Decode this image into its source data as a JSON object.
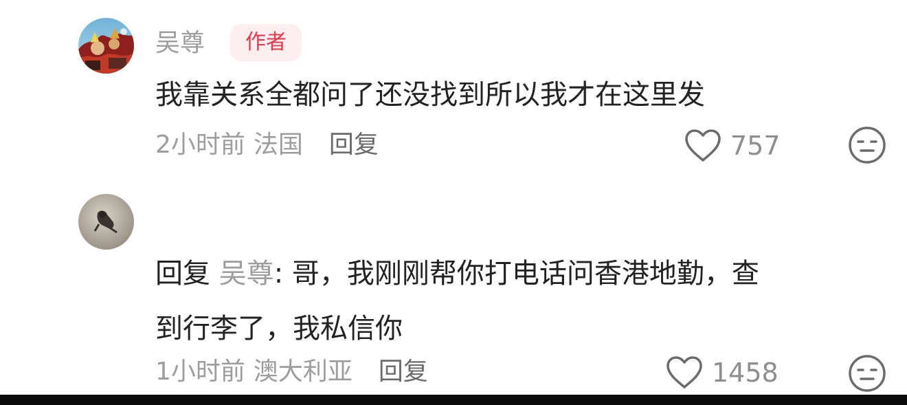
{
  "comments": [
    {
      "username": "吴尊",
      "badge": "作者",
      "text": "我靠关系全都问了还没找到所以我才在这里发",
      "time": "2小时前",
      "location": "法国",
      "reply_label": "回复",
      "likes": "757",
      "like_icon": "heart-outline-icon",
      "dislike_icon": "meh-face-icon"
    },
    {
      "reply_prefix": "回复",
      "reply_to": "吴尊",
      "text_line1": ": 哥，我刚刚帮你打电话问香港地勤，查",
      "text_line2": "到行李了，我私信你",
      "time": "1小时前",
      "location": "澳大利亚",
      "reply_label": "回复",
      "likes": "1458",
      "like_icon": "heart-outline-icon",
      "dislike_icon": "meh-face-icon"
    }
  ],
  "colors": {
    "badge_bg": "#fdeef0",
    "badge_text": "#e8364b",
    "secondary_text": "#9d9d9d",
    "primary_text": "#222222"
  }
}
